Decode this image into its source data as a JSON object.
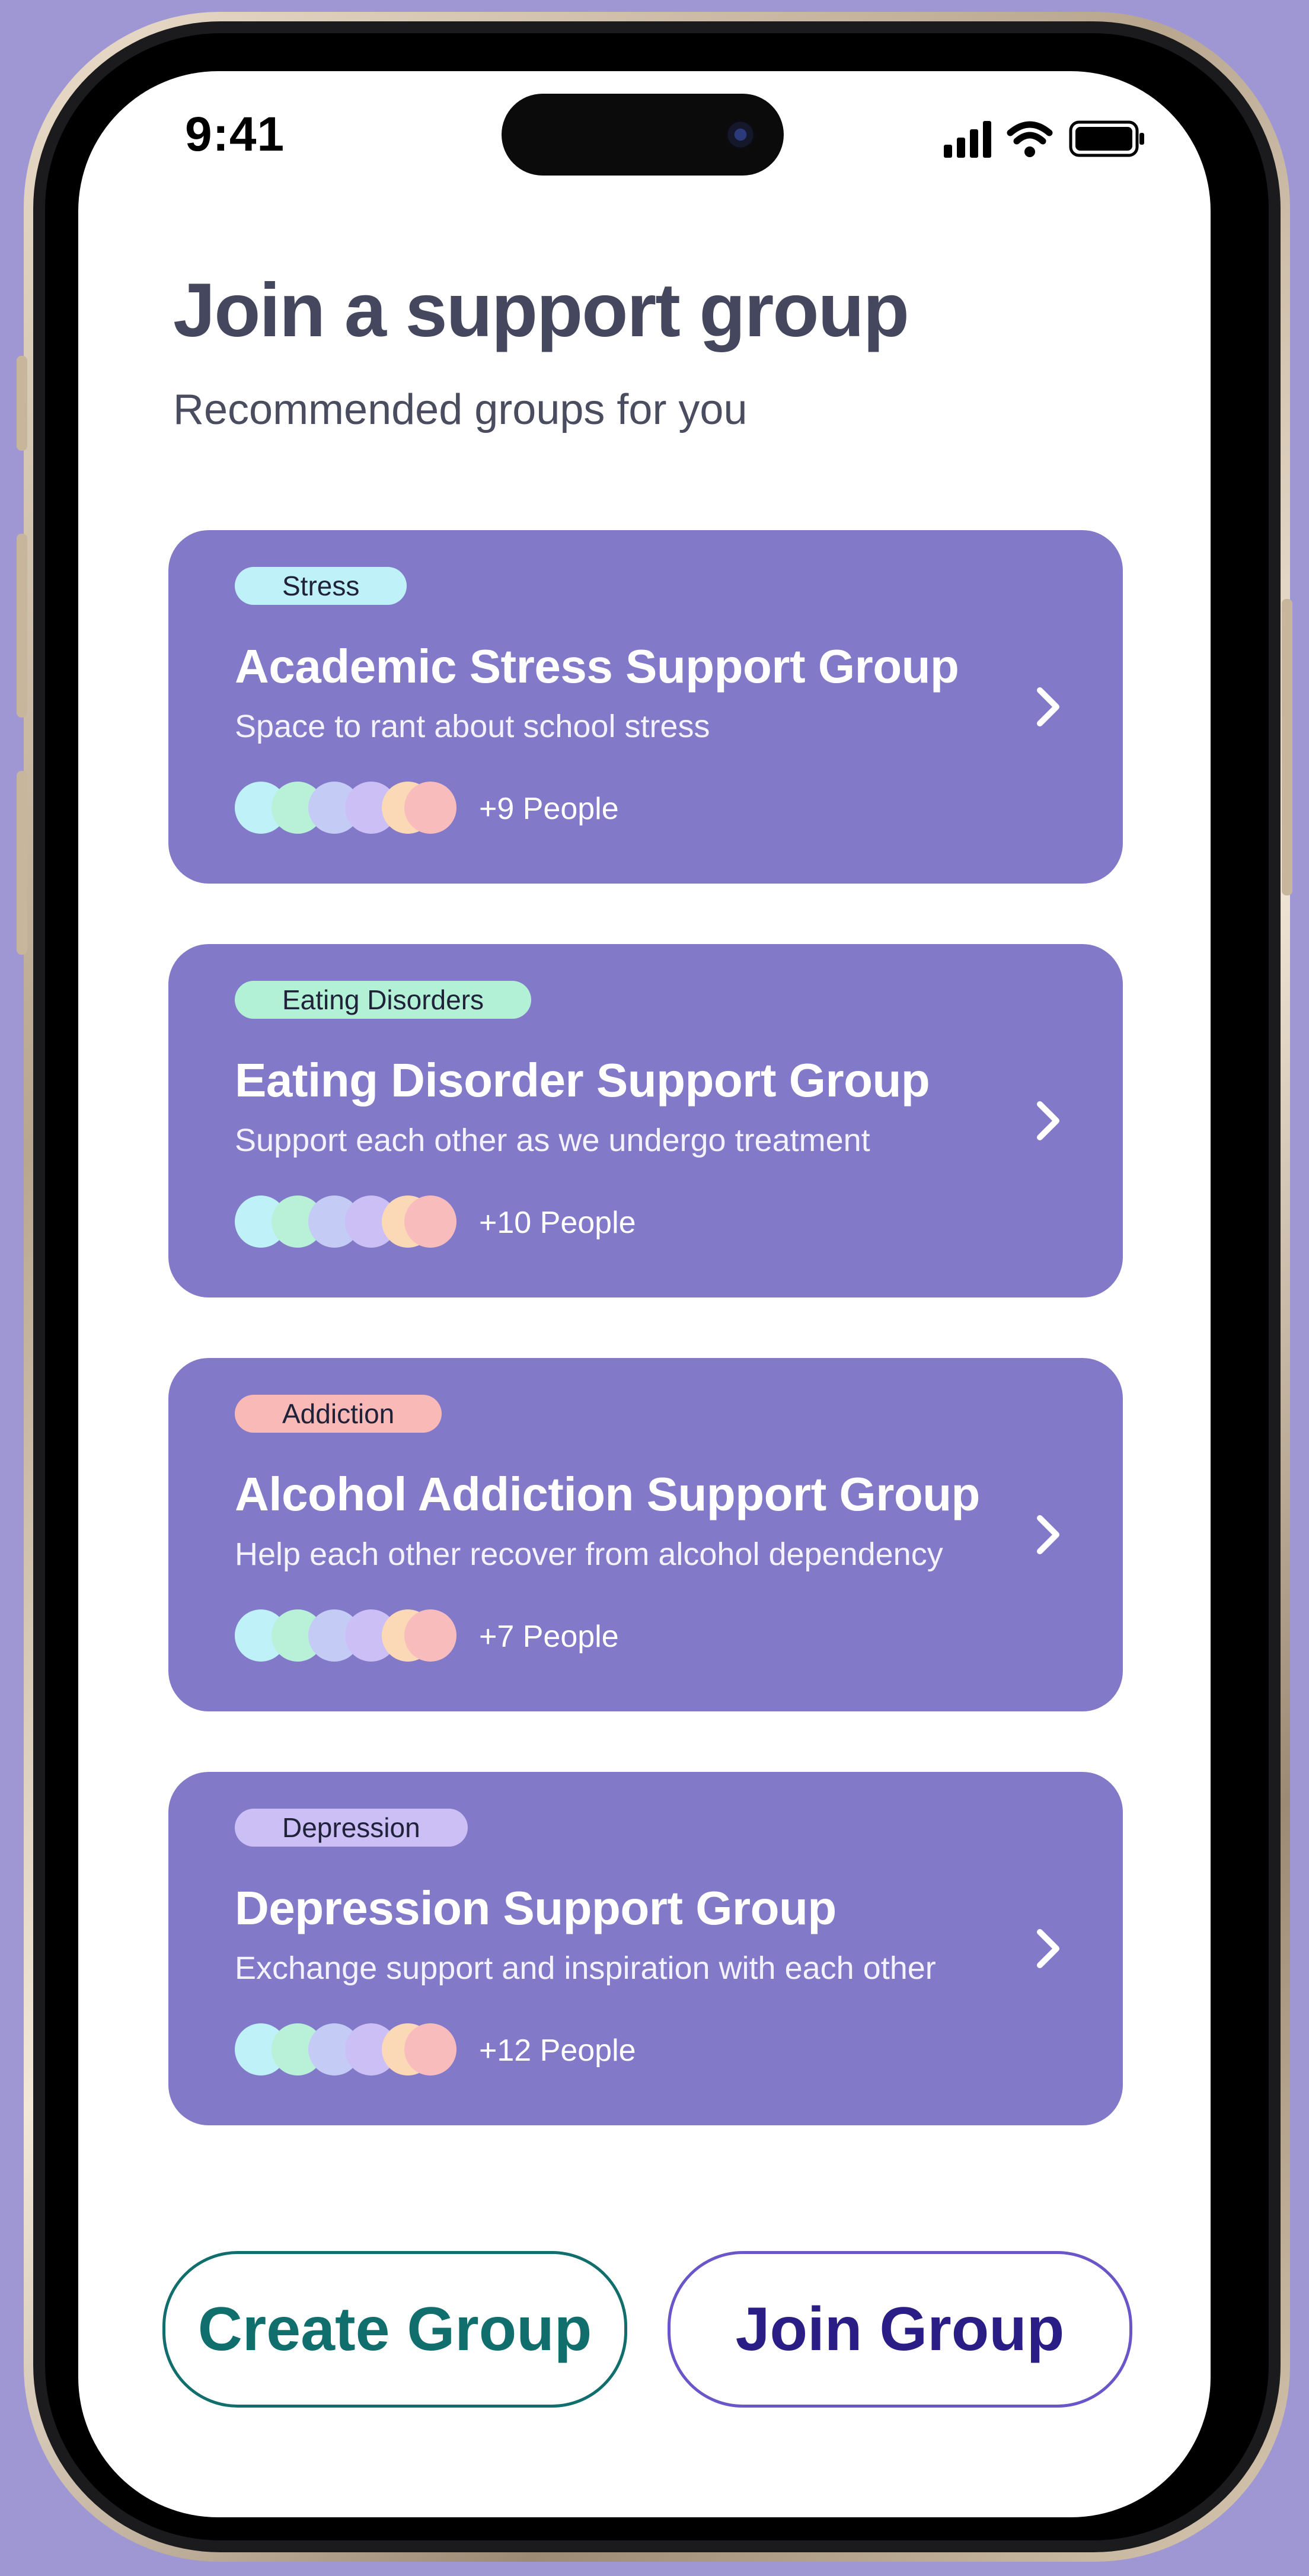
{
  "status_bar": {
    "time": "9:41"
  },
  "header": {
    "title": "Join a support group",
    "subtitle": "Recommended groups for you"
  },
  "colors": {
    "card_bg": "#8379c9",
    "avatar_colors": [
      "#bff1f9",
      "#b8f0d8",
      "#c4ccf5",
      "#cbbff5",
      "#fcd9b6",
      "#f9bcbc"
    ],
    "create_accent": "#106e6c",
    "join_accent": "#6a56c9"
  },
  "groups": [
    {
      "tag": "Stress",
      "tag_color": "#bff1f9",
      "title": "Academic Stress Support Group",
      "description": "Space to rant about school stress",
      "people": "+9 People"
    },
    {
      "tag": "Eating Disorders",
      "tag_color": "#b3f1d6",
      "title": "Eating Disorder Support Group",
      "description": "Support each other as we undergo treatment",
      "people": "+10 People"
    },
    {
      "tag": "Addiction",
      "tag_color": "#f9b9b7",
      "title": "Alcohol Addiction Support Group",
      "description": "Help each other recover from alcohol dependency",
      "people": "+7 People"
    },
    {
      "tag": "Depression",
      "tag_color": "#cbbff5",
      "title": "Depression Support Group",
      "description": "Exchange support and inspiration with each other",
      "people": "+12 People"
    }
  ],
  "actions": {
    "create_label": "Create Group",
    "join_label": "Join Group"
  }
}
